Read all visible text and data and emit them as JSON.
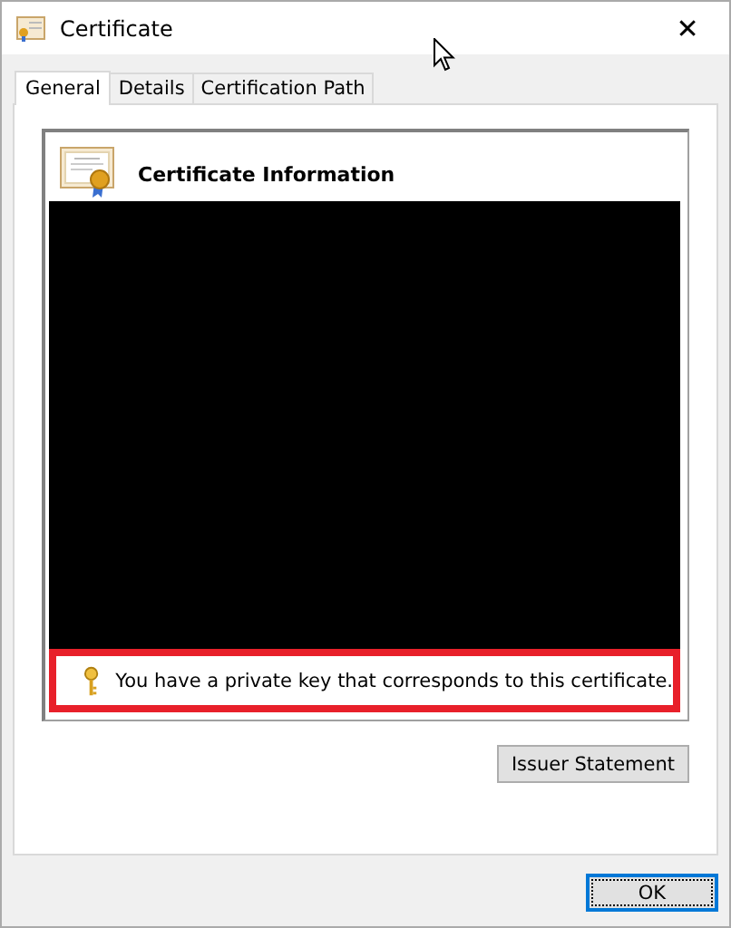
{
  "window": {
    "title": "Certificate",
    "close": "✕"
  },
  "tabs": [
    {
      "label": "General",
      "selected": true
    },
    {
      "label": "Details",
      "selected": false
    },
    {
      "label": "Certification Path",
      "selected": false
    }
  ],
  "certificate_info": {
    "heading": "Certificate Information",
    "redacted": true,
    "key_note": "You have a private key that corresponds to this certificate.",
    "key_note_highlighted": true
  },
  "buttons": {
    "issuer_statement": "Issuer Statement",
    "ok": "OK"
  }
}
